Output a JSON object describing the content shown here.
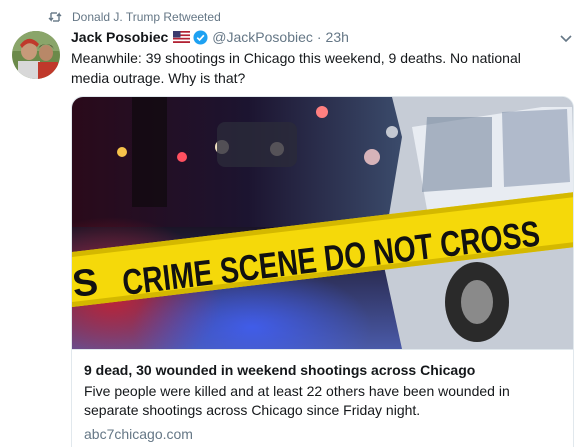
{
  "retweet_context": {
    "label": "Donald J. Trump Retweeted",
    "icon": "retweet-icon"
  },
  "tweet": {
    "author_name": "Jack Posobiec",
    "flag_icon": "us-flag-icon",
    "verified_icon": "verified-badge-icon",
    "handle": "@JackPosobiec",
    "separator": "·",
    "time": "23h",
    "text": "Meanwhile: 39 shootings in Chicago this weekend, 9 deaths. No national media outrage. Why is that?",
    "menu_icon": "chevron-down-icon"
  },
  "card": {
    "image_tape_text": "CRIME SCENE DO NOT CROSS",
    "image_tape_fragment": "S",
    "title": "9 dead, 30 wounded in weekend shootings across Chicago",
    "description": "Five people were killed and at least 22 others have been wounded in separate shootings across Chicago since Friday night.",
    "domain": "abc7chicago.com"
  },
  "colors": {
    "primary_text": "#14171a",
    "secondary_text": "#657786",
    "border": "#e1e8ed",
    "verified_blue": "#1da1f2",
    "tape_yellow": "#f5d90a"
  }
}
